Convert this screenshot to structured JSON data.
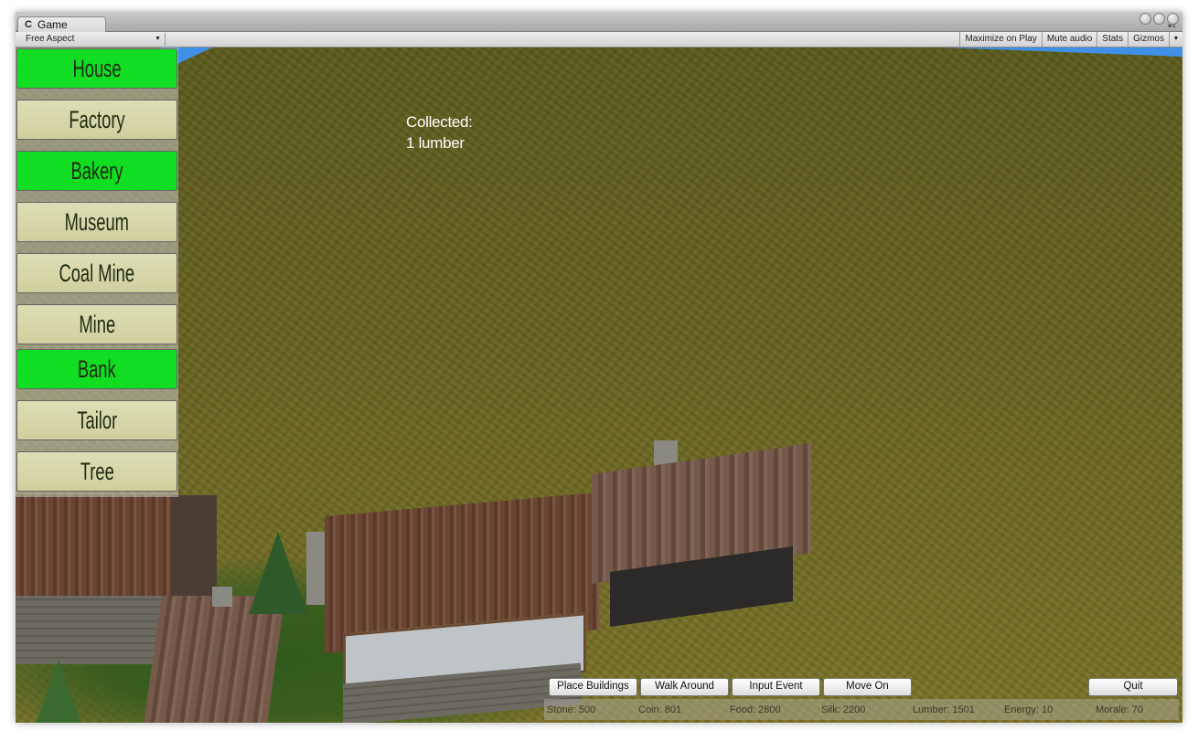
{
  "window": {
    "tab_label": "Game",
    "tab_icon": "unity-icon",
    "aspect_label": "Free Aspect",
    "toolbar_buttons": [
      "Maximize on Play",
      "Mute audio",
      "Stats",
      "Gizmos"
    ]
  },
  "building_menu": [
    {
      "label": "House",
      "state": "selected"
    },
    {
      "label": "Factory",
      "state": "normal"
    },
    {
      "label": "Bakery",
      "state": "selected"
    },
    {
      "label": "Museum",
      "state": "normal"
    },
    {
      "label": "Coal Mine",
      "state": "normal"
    },
    {
      "label": "Mine",
      "state": "normal"
    },
    {
      "label": "Bank",
      "state": "selected"
    },
    {
      "label": "Tailor",
      "state": "normal"
    },
    {
      "label": "Tree",
      "state": "normal"
    }
  ],
  "notification": {
    "line1": "Collected:",
    "line2": "1 lumber"
  },
  "actions": {
    "place_buildings": "Place Buildings",
    "walk_around": "Walk Around",
    "input_event": "Input Event",
    "move_on": "Move On",
    "quit": "Quit"
  },
  "resources": [
    {
      "label": "Stone: 500"
    },
    {
      "label": "Coin: 801"
    },
    {
      "label": "Food: 2800"
    },
    {
      "label": "Silk: 2200"
    },
    {
      "label": "Lumber: 1501"
    },
    {
      "label": "Energy: 10"
    },
    {
      "label": "Morale: 70"
    }
  ],
  "colors": {
    "selected": "#11dd22",
    "normal": "#d8d8ab",
    "terrain": "#5f5c1f",
    "sky": "#3f90e6"
  }
}
